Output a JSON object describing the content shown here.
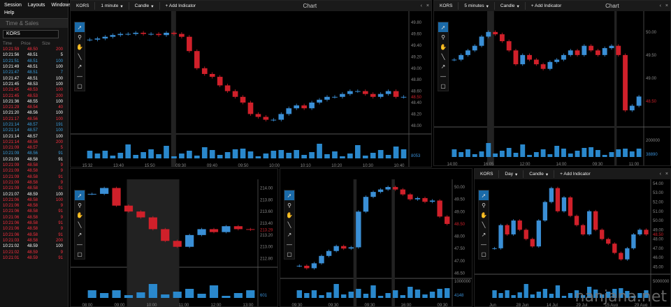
{
  "menu": {
    "items": [
      "Session",
      "Layouts",
      "Windows"
    ],
    "help": "Help"
  },
  "time_sales": {
    "title": "Time & Sales",
    "symbol": "KORS",
    "headers": [
      "Time",
      "Price",
      "Size"
    ],
    "rows": [
      [
        "10:21:59",
        "48.50",
        "200",
        "#ff3040"
      ],
      [
        "10:21:56",
        "48.51",
        "5",
        "#fff"
      ],
      [
        "10:21:51",
        "48.51",
        "100",
        "#3ca0e0"
      ],
      [
        "10:21:49",
        "48.51",
        "100",
        "#fff"
      ],
      [
        "10:21:47",
        "48.51",
        "7",
        "#3ca0e0"
      ],
      [
        "10:21:47",
        "48.51",
        "100",
        "#fff"
      ],
      [
        "10:21:45",
        "48.53",
        "100",
        "#fff"
      ],
      [
        "10:21:45",
        "48.53",
        "100",
        "#ff3040"
      ],
      [
        "10:21:45",
        "48.53",
        "200",
        "#ff3040"
      ],
      [
        "10:21:36",
        "48.55",
        "100",
        "#fff"
      ],
      [
        "10:21:29",
        "48.54",
        "40",
        "#ff3040"
      ],
      [
        "10:21:20",
        "48.56",
        "100",
        "#fff"
      ],
      [
        "10:21:17",
        "48.56",
        "100",
        "#ff3040"
      ],
      [
        "10:21:14",
        "48.57",
        "191",
        "#3ca0e0"
      ],
      [
        "10:21:14",
        "48.57",
        "100",
        "#3ca0e0"
      ],
      [
        "10:21:14",
        "48.57",
        "100",
        "#fff"
      ],
      [
        "10:21:14",
        "48.56",
        "200",
        "#ff3040"
      ],
      [
        "10:21:09",
        "48.57",
        "5",
        "#ff3040"
      ],
      [
        "10:21:09",
        "48.56",
        "91",
        "#3ca0e0"
      ],
      [
        "10:21:09",
        "48.58",
        "91",
        "#fff"
      ],
      [
        "10:21:09",
        "48.58",
        "9",
        "#ff3040"
      ],
      [
        "10:21:09",
        "48.58",
        "9",
        "#ff3040"
      ],
      [
        "10:21:09",
        "48.58",
        "91",
        "#ff3040"
      ],
      [
        "10:21:09",
        "48.58",
        "9",
        "#ff3040"
      ],
      [
        "10:21:09",
        "48.58",
        "91",
        "#ff3040"
      ],
      [
        "10:21:07",
        "48.59",
        "100",
        "#fff"
      ],
      [
        "10:21:06",
        "48.58",
        "100",
        "#ff3040"
      ],
      [
        "10:21:06",
        "48.58",
        "9",
        "#ff3040"
      ],
      [
        "10:21:06",
        "48.58",
        "91",
        "#ff3040"
      ],
      [
        "10:21:06",
        "48.58",
        "9",
        "#ff3040"
      ],
      [
        "10:21:06",
        "48.58",
        "91",
        "#ff3040"
      ],
      [
        "10:21:06",
        "48.58",
        "9",
        "#ff3040"
      ],
      [
        "10:21:06",
        "48.58",
        "91",
        "#ff3040"
      ],
      [
        "10:21:03",
        "48.58",
        "200",
        "#ff3040"
      ],
      [
        "10:21:02",
        "48.59",
        "100",
        "#fff"
      ],
      [
        "10:21:02",
        "48.59",
        "9",
        "#ff3040"
      ],
      [
        "10:21:01",
        "48.59",
        "91",
        "#ff3040"
      ]
    ]
  },
  "tools": [
    "pointer",
    "zoom",
    "hand",
    "line",
    "arrow",
    "hline",
    "rect"
  ],
  "charts": [
    {
      "symbol": "KORS",
      "interval": "1 minute",
      "type": "Candle",
      "add": "+ Add Indicator",
      "title": "Chart",
      "yticks": [
        "49.80",
        "49.60",
        "49.40",
        "49.20",
        "49.00",
        "48.80",
        "48.60",
        "48.40",
        "48.20",
        "48.00"
      ],
      "ymark": "48.50",
      "vmark": "8053",
      "xticks": [
        "15:32",
        "13:40",
        "15:50",
        "09:30",
        "09:40",
        "09:50",
        "10:00",
        "10:10",
        "10:20",
        "10:30",
        "10:40"
      ]
    },
    {
      "symbol": "KORS",
      "interval": "5 minutes",
      "type": "Candle",
      "add": "+ Add Indicator",
      "title": "Chart",
      "yticks": [
        "50.00",
        "49.50",
        "49.00",
        "48.50"
      ],
      "ymark": "48.50",
      "vticks": [
        "200000"
      ],
      "vmark": "38890",
      "xticks": [
        "14:00",
        "16:05",
        "12:00",
        "14:00",
        "09:30",
        "11:00"
      ]
    },
    {
      "yticks": [
        "214.00",
        "213.80",
        "213.60",
        "213.40",
        "213.20",
        "213.00",
        "212.80"
      ],
      "ymark": "213.29",
      "vmark": "601",
      "xticks": [
        "08:00",
        "09:00",
        "10:00",
        "11:00",
        "12:00",
        "13:00"
      ]
    },
    {
      "yticks": [
        "50.00",
        "49.50",
        "49.00",
        "48.50",
        "48.00",
        "47.50",
        "47.00",
        "46.50"
      ],
      "ymark": "48.50",
      "vticks": [
        "1000000"
      ],
      "vmark": "4148",
      "xticks": [
        "09:30",
        "09:30",
        "09:30",
        "16:00",
        "09:30"
      ]
    },
    {
      "symbol": "KORS",
      "interval": "Day",
      "type": "Candle",
      "add": "+ Add Indicator",
      "yticks": [
        "54.00",
        "53.00",
        "52.00",
        "51.00",
        "50.00",
        "49.00",
        "48.00",
        "47.00",
        "46.00",
        "45.00"
      ],
      "ymark": "48.50",
      "vticks": [
        "5000000"
      ],
      "xticks": [
        "Jun",
        "28 Jun",
        "14 Jul",
        "29 Jul",
        "15 Aug",
        "29 Aug"
      ]
    }
  ],
  "watermark": "nanjana.net",
  "colors": {
    "up": "#3a8fd6",
    "down": "#d0202a",
    "vol": "#2a88cc",
    "select": "#1a6aa8"
  },
  "chart_data": [
    {
      "type": "candlestick",
      "title": "Chart",
      "symbol": "KORS",
      "interval": "1 minute",
      "close": [
        49.5,
        49.52,
        49.55,
        49.58,
        49.6,
        49.6,
        49.62,
        49.6,
        49.6,
        49.58,
        49.62,
        49.6,
        49.55,
        49.3,
        49.0,
        48.9,
        48.85,
        48.7,
        48.6,
        48.5,
        48.4,
        48.2,
        48.15,
        48.1,
        48.1,
        48.2,
        48.3,
        48.35,
        48.3,
        48.4,
        48.45,
        48.5,
        48.5,
        48.55,
        48.6,
        48.6,
        48.55,
        48.5,
        48.55,
        48.6,
        48.5,
        48.5
      ],
      "ylim": [
        47.9,
        49.9
      ]
    },
    {
      "type": "candlestick",
      "title": "Chart",
      "symbol": "KORS",
      "interval": "5 minutes",
      "close": [
        49.4,
        49.5,
        49.6,
        49.7,
        49.9,
        50.0,
        49.95,
        49.8,
        49.6,
        49.3,
        49.5,
        49.4,
        49.3,
        49.2,
        49.35,
        49.4,
        49.5,
        49.6,
        49.5,
        49.7,
        49.6,
        49.5,
        49.65,
        49.7,
        49.5,
        48.3,
        48.4,
        48.6
      ],
      "ylim": [
        48.0,
        50.3
      ]
    },
    {
      "type": "candlestick",
      "close": [
        213.9,
        214.0,
        213.7,
        213.6,
        213.5,
        213.3,
        213.1,
        213.0,
        213.2,
        213.3,
        213.25,
        213.35,
        213.3,
        213.29
      ],
      "ylim": [
        212.7,
        214.1
      ]
    },
    {
      "type": "candlestick",
      "close": [
        46.8,
        46.7,
        46.9,
        47.2,
        47.4,
        47.6,
        47.5,
        47.55,
        49.0,
        49.6,
        49.8,
        49.9,
        50.0,
        49.9,
        49.7,
        49.5,
        49.55,
        49.4,
        49.45,
        48.8,
        48.5
      ],
      "ylim": [
        46.4,
        50.2
      ]
    },
    {
      "type": "candlestick",
      "interval": "Day",
      "close": [
        47.0,
        49.5,
        48.5,
        50.0,
        49.0,
        48.0,
        47.2,
        50.0,
        52.0,
        53.5,
        51.0,
        52.5,
        50.5,
        49.5,
        48.5,
        51.0,
        49.0,
        48.0,
        47.5,
        46.5,
        45.8,
        47.0,
        48.5,
        49.0,
        48.5
      ],
      "ylim": [
        44.5,
        54.3
      ]
    }
  ]
}
